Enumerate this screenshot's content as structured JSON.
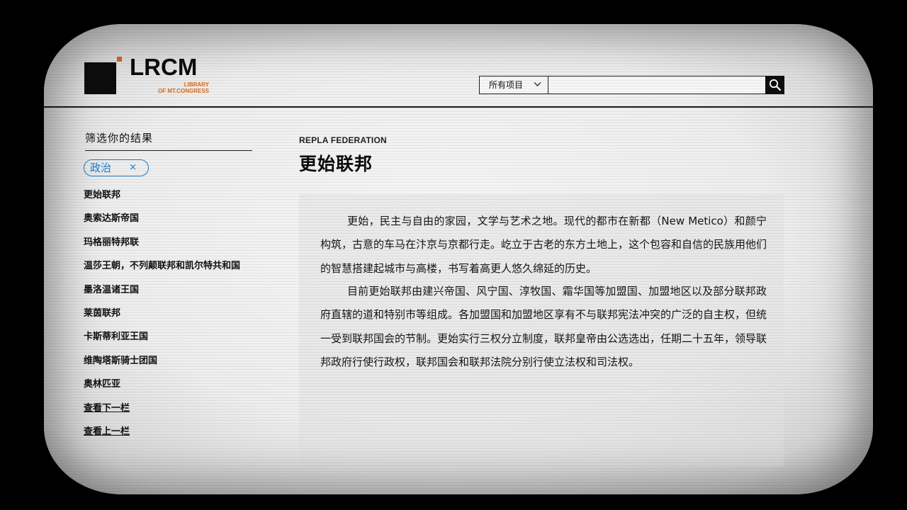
{
  "header": {
    "logo": {
      "name": "LRCM",
      "sub_line1": "LIBRARY",
      "sub_line2": "OF MT.CONGRESS"
    },
    "search": {
      "scope_label": "所有项目",
      "scope_icon": "chevron-down-icon",
      "placeholder": "",
      "button_icon": "search-icon"
    }
  },
  "sidebar": {
    "filter_title": "筛选你的结果",
    "active_filter": {
      "label": "政治",
      "close": "×"
    },
    "items": [
      {
        "label": "更始联邦"
      },
      {
        "label": "奥索达斯帝国"
      },
      {
        "label": "玛格丽特邦联"
      },
      {
        "label": "温莎王朝，不列颠联邦和凯尔特共和国"
      },
      {
        "label": "墨洛温诸王国"
      },
      {
        "label": "莱茵联邦"
      },
      {
        "label": "卡斯蒂利亚王国"
      },
      {
        "label": "维陶塔斯骑士团国"
      },
      {
        "label": "奥林匹亚"
      }
    ],
    "pagination": {
      "next": "查看下一栏",
      "prev": "查看上一栏"
    }
  },
  "main": {
    "eyebrow": "REPLA FEDERATION",
    "title": "更始联邦",
    "paragraphs": [
      "更始，民主与自由的家园，文学与艺术之地。现代的都市在新都（New Metico）和颜宁构筑，古意的车马在汴京与京都行走。屹立于古老的东方土地上，这个包容和自信的民族用他们的智慧搭建起城市与高楼，书写着高更人悠久绵延的历史。",
      "目前更始联邦由建兴帝国、风宁国、淳牧国、霜华国等加盟国、加盟地区以及部分联邦政府直辖的道和特别市等组成。各加盟国和加盟地区享有不与联邦宪法冲突的广泛的自主权，但统一受到联邦国会的节制。更始实行三权分立制度，联邦皇帝由公选选出，任期二十五年，领导联邦政府行使行政权，联邦国会和联邦法院分别行使立法权和司法权。"
    ]
  },
  "colors": {
    "accent": "#d86a1e",
    "link": "#1a7cc7",
    "ink": "#111111"
  }
}
